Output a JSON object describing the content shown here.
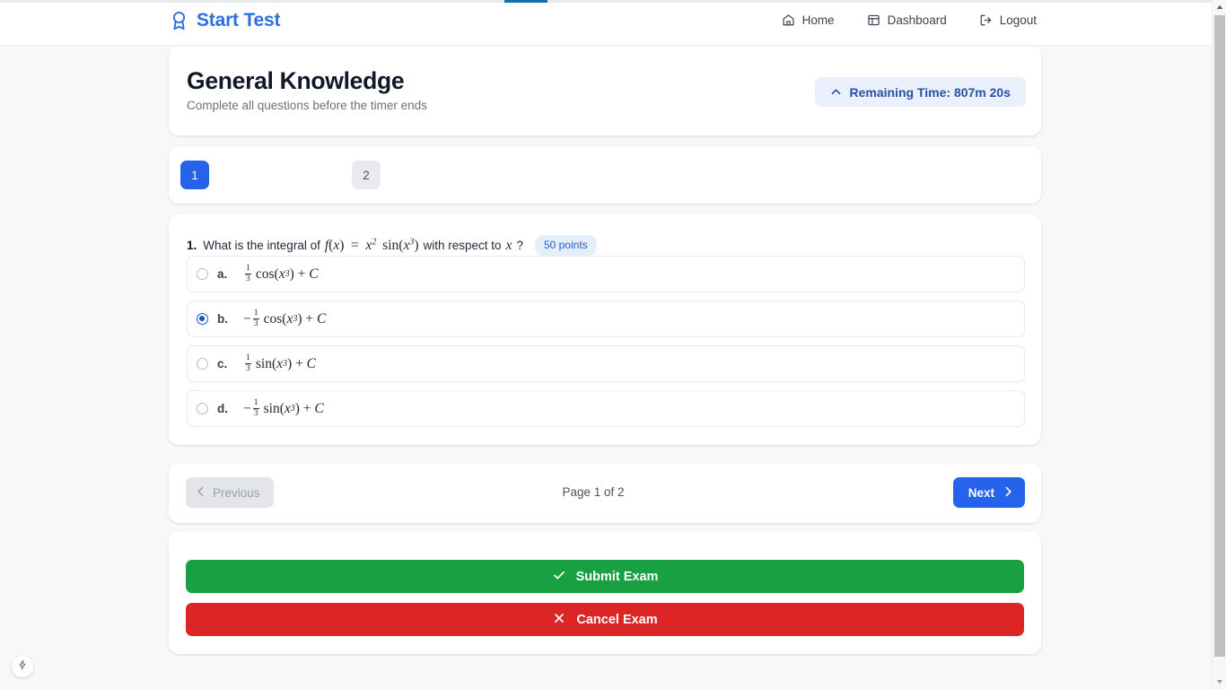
{
  "header": {
    "brand": "Start Test",
    "brand_icon": "award-ribbon-icon",
    "brand_color": "#2f6fe0",
    "nav": [
      {
        "label": "Home",
        "icon": "home-icon"
      },
      {
        "label": "Dashboard",
        "icon": "dashboard-layout-icon"
      },
      {
        "label": "Logout",
        "icon": "logout-icon"
      }
    ]
  },
  "progress_bar": {
    "accent_color": "#1173a8"
  },
  "exam": {
    "title": "General Knowledge",
    "subtitle": "Complete all questions before the timer ends",
    "timer": {
      "label": "Remaining Time: 807m 20s",
      "icon": "chevron-up-icon",
      "background": "#eaf1fd",
      "text_color": "#2851a3"
    }
  },
  "page_tabs": [
    {
      "label": "1",
      "active": true
    },
    {
      "label": "2",
      "active": false
    }
  ],
  "question": {
    "number": "1.",
    "prompt_prefix": "What is the integral of",
    "expression": "f(x) = x^2 sin(x^3)",
    "prompt_suffix_a": "with respect to",
    "variable": "x",
    "question_mark": "?",
    "points_badge": "50 points",
    "options": [
      {
        "letter": "a.",
        "value": "1/3 cos(x^3) + C",
        "selected": false
      },
      {
        "letter": "b.",
        "value": "-1/3 cos(x^3) + C",
        "selected": true
      },
      {
        "letter": "c.",
        "value": "1/3 sin(x^3) + C",
        "selected": false
      },
      {
        "letter": "d.",
        "value": "-1/3 sin(x^3) + C",
        "selected": false
      }
    ]
  },
  "pagination": {
    "previous_label": "Previous",
    "next_label": "Next",
    "page_indicator": "Page 1 of 2",
    "previous_disabled": true
  },
  "actions": {
    "submit_label": "Submit Exam",
    "submit_icon": "check-icon",
    "submit_color": "#19a043",
    "cancel_label": "Cancel Exam",
    "cancel_icon": "x-icon",
    "cancel_color": "#dc2626"
  },
  "fab": {
    "icon": "lightning-bolt-icon"
  }
}
